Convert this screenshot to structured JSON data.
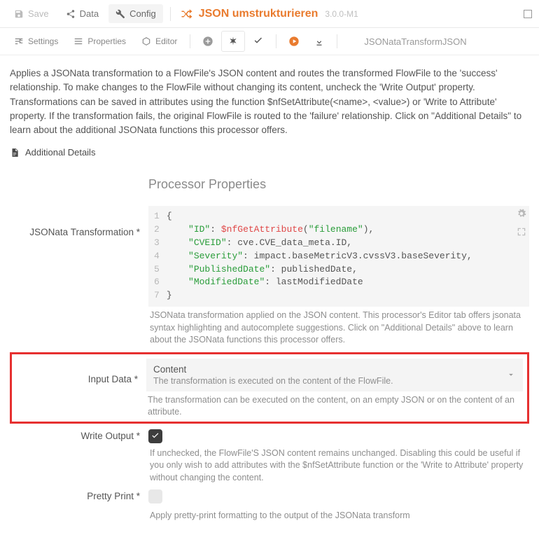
{
  "toolbar": {
    "save": "Save",
    "data": "Data",
    "config": "Config",
    "title": "JSON umstrukturieren",
    "version": "3.0.0-M1"
  },
  "tabs": {
    "settings": "Settings",
    "properties": "Properties",
    "editor": "Editor"
  },
  "breadcrumb": "JSONataTransformJSON",
  "description": "Applies a JSONata transformation to a FlowFile's JSON content and routes the transformed FlowFile to the 'success' relationship. To make changes to the FlowFile without changing its content, uncheck the 'Write Output' property. Transformations can be saved in attributes using the function $nfSetAttribute(<name>, <value>) or 'Write to Attribute' property. If the transformation fails, the original FlowFile is routed to the 'failure' relationship. Click on \"Additional Details\" to learn about the additional JSONata functions this processor offers.",
  "addl_details": "Additional Details",
  "section_title": "Processor Properties",
  "props": {
    "jsonata": {
      "label": "JSONata Transformation *",
      "help": "JSONata transformation applied on the JSON content. This processor's Editor tab offers jsonata syntax highlighting and autocomplete suggestions. Click on \"Additional Details\" above to learn about the JSONata functions this processor offers."
    },
    "input": {
      "label": "Input Data *",
      "value_title": "Content",
      "value_sub": "The transformation is executed on the content of the FlowFile.",
      "help": "The transformation can be executed on the content, on an empty JSON or on the content of an attribute."
    },
    "write": {
      "label": "Write Output *",
      "help": "If unchecked, the FlowFile'S JSON content remains unchanged. Disabling this could be useful if you only wish to add attributes with the $nfSetAttribute function or the 'Write to Attribute' property without changing the content."
    },
    "pretty": {
      "label": "Pretty Print *",
      "help": "Apply pretty-print formatting to the output of the JSONata transform"
    }
  },
  "code": {
    "l1": "{",
    "l2a": "\"ID\"",
    "l2b": ": ",
    "l2c": "$nfGetAttribute",
    "l2d": "(",
    "l2e": "\"filename\"",
    "l2f": "),",
    "l3a": "\"CVEID\"",
    "l3b": ": cve.CVE_data_meta.ID,",
    "l4a": "\"Severity\"",
    "l4b": ": impact.baseMetricV3.cvssV3.baseSeverity,",
    "l5a": "\"PublishedDate\"",
    "l5b": ": publishedDate,",
    "l6a": "\"ModifiedDate\"",
    "l6b": ": lastModifiedDate",
    "l7": "}"
  }
}
